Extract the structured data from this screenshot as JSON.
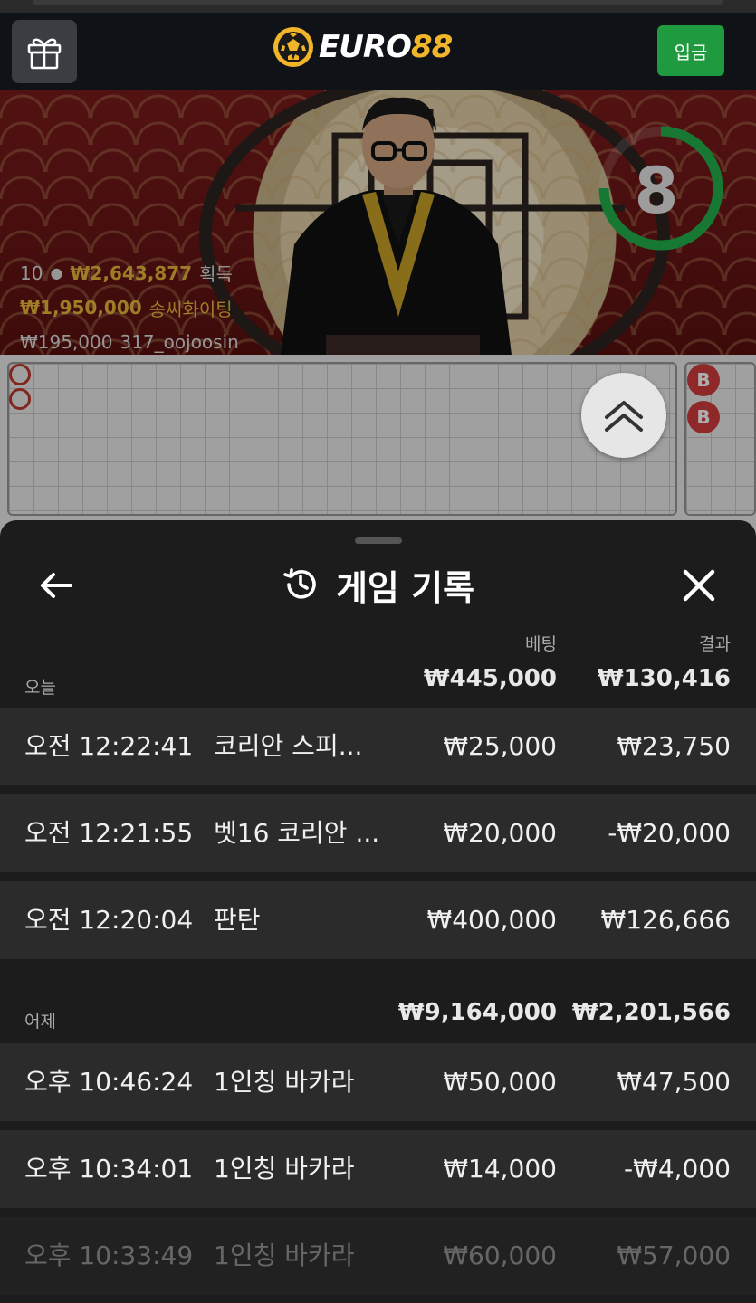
{
  "header": {
    "logo_word": "EURO",
    "logo_number": "88",
    "deposit_label": "입금"
  },
  "video": {
    "timer_value": "8",
    "winners": [
      {
        "count": "10",
        "amount": "₩2,643,877",
        "suffix": "획득"
      },
      {
        "amount": "₩1,950,000",
        "name": "송씨화이팅"
      },
      {
        "amount": "₩195,000",
        "name": "317_oojoosin"
      }
    ]
  },
  "roadmap": {
    "bead_labels": [
      "B",
      "B"
    ]
  },
  "history": {
    "title": "게임 기록",
    "col_bet": "베팅",
    "col_result": "결과",
    "groups": [
      {
        "label": "오늘",
        "total_bet": "₩445,000",
        "total_result": "₩130,416",
        "rows": [
          {
            "time": "오전 12:22:41",
            "game": "코리안 스피...",
            "bet": "₩25,000",
            "result": "₩23,750"
          },
          {
            "time": "오전 12:21:55",
            "game": "벳16 코리안 ...",
            "bet": "₩20,000",
            "result": "-₩20,000"
          },
          {
            "time": "오전 12:20:04",
            "game": "판탄",
            "bet": "₩400,000",
            "result": "₩126,666"
          }
        ]
      },
      {
        "label": "어제",
        "total_bet": "₩9,164,000",
        "total_result": "₩2,201,566",
        "rows": [
          {
            "time": "오후 10:46:24",
            "game": "1인칭 바카라",
            "bet": "₩50,000",
            "result": "₩47,500"
          },
          {
            "time": "오후 10:34:01",
            "game": "1인칭 바카라",
            "bet": "₩14,000",
            "result": "-₩4,000"
          },
          {
            "time": "오후 10:33:49",
            "game": "1인칭 바카라",
            "bet": "₩60,000",
            "result": "₩57,000"
          }
        ]
      }
    ]
  },
  "colors": {
    "accent_green": "#1f9a3e",
    "logo_gold": "#f2b52a",
    "winner_gold": "#e7b83a",
    "timer_green": "#22b14c",
    "banker_red": "#d33d3d"
  }
}
